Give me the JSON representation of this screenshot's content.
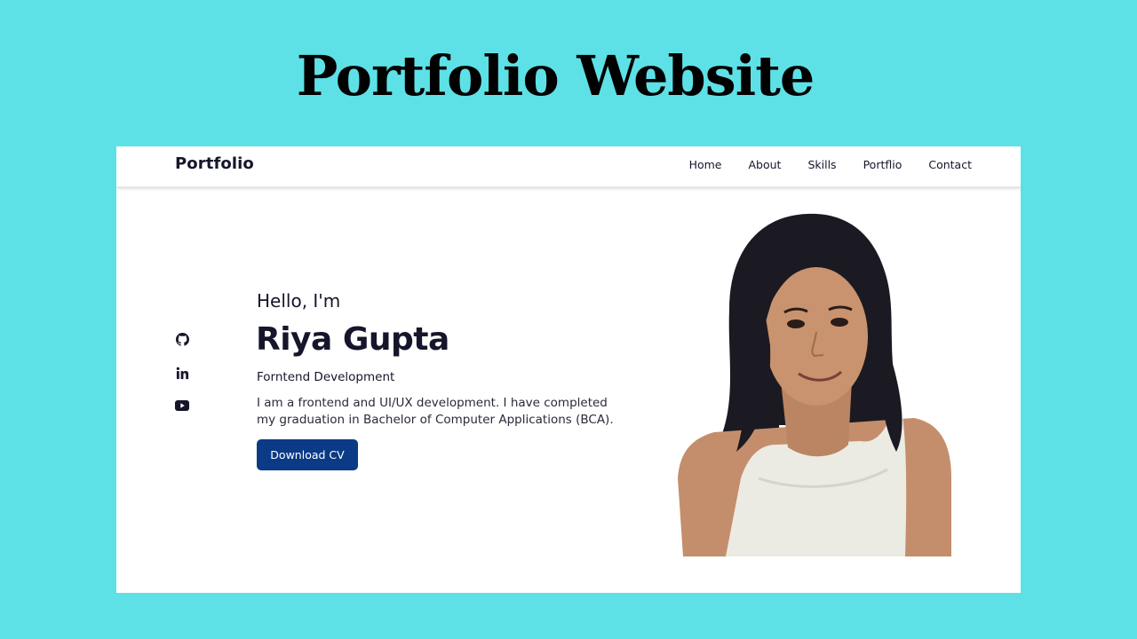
{
  "banner": {
    "title": "Portfolio Website",
    "background_color": "#5ee1e6"
  },
  "navbar": {
    "logo": "Portfolio",
    "items": [
      {
        "label": "Home"
      },
      {
        "label": "About"
      },
      {
        "label": "Skills"
      },
      {
        "label": "Portflio"
      },
      {
        "label": "Contact"
      }
    ]
  },
  "social": [
    {
      "icon": "github-icon"
    },
    {
      "icon": "linkedin-icon"
    },
    {
      "icon": "youtube-icon"
    }
  ],
  "hero": {
    "greeting": "Hello, I'm",
    "name": "Riya Gupta",
    "role": "Forntend Development",
    "description": "I am a frontend and UI/UX development. I have completed my graduation in Bachelor of Computer Applications (BCA).",
    "cv_button": "Download CV",
    "button_color": "#0b3a86",
    "portrait_icon": "profile-photo"
  }
}
